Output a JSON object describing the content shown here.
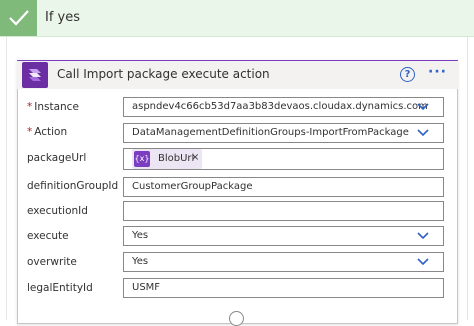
{
  "branch": {
    "title": "If yes",
    "accent_color": "#7fba7a"
  },
  "action_card": {
    "title": "Call Import package execute action",
    "accent_color": "#7b3ec0",
    "icon": "finance-operations-icon",
    "help_icon": "?",
    "more_icon": "···"
  },
  "fields": {
    "instance": {
      "label": "Instance",
      "required": "*",
      "value": "aspndev4c66cb53d7aa3b83devaos.cloudax.dynamics.com"
    },
    "action": {
      "label": "Action",
      "required": "*",
      "value": "DataManagementDefinitionGroups-ImportFromPackage"
    },
    "packageUrl": {
      "label": "packageUrl",
      "token_icon": "{x}",
      "token_label": "BlobUrl",
      "token_remove": "×"
    },
    "definitionGroupId": {
      "label": "definitionGroupId",
      "value": "CustomerGroupPackage"
    },
    "executionId": {
      "label": "executionId",
      "value": ""
    },
    "execute": {
      "label": "execute",
      "value": "Yes"
    },
    "overwrite": {
      "label": "overwrite",
      "value": "Yes"
    },
    "legalEntityId": {
      "label": "legalEntityId",
      "value": "USMF"
    }
  }
}
